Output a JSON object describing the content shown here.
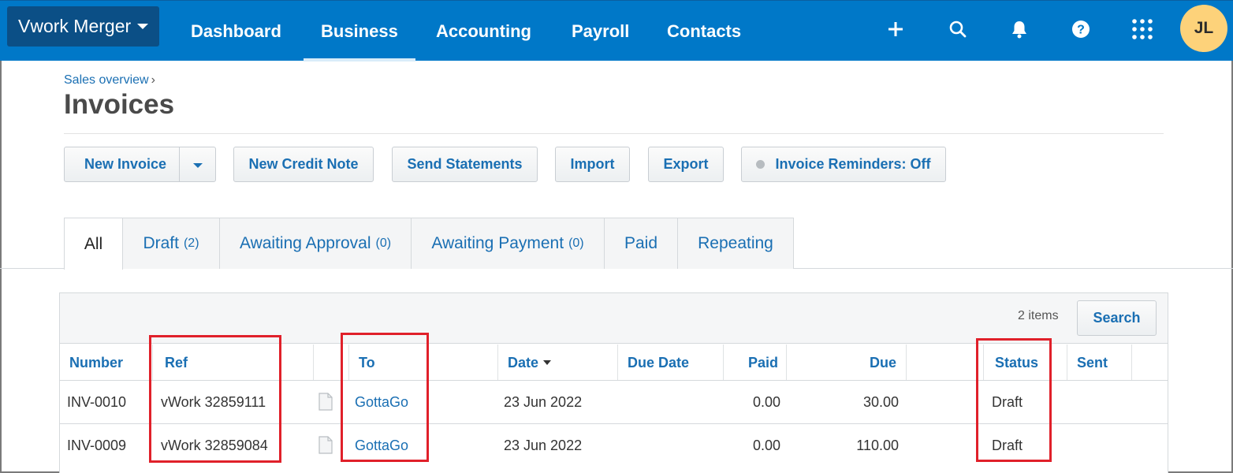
{
  "topnav": {
    "org_name": "Vwork Merger",
    "items": [
      {
        "label": "Dashboard"
      },
      {
        "label": "Business"
      },
      {
        "label": "Accounting"
      },
      {
        "label": "Payroll"
      },
      {
        "label": "Contacts"
      }
    ],
    "active": "Business",
    "icons": [
      "plus-icon",
      "search-icon",
      "bell-icon",
      "help-icon",
      "apps-grid-icon"
    ],
    "avatar_initials": "JL",
    "colors": {
      "bar": "#0078c8",
      "org_button": "#0b4f86",
      "avatar": "#fdd27a"
    }
  },
  "breadcrumb": {
    "label": "Sales overview",
    "separator": "›"
  },
  "page_title": "Invoices",
  "toolbar": {
    "new_invoice": "New Invoice",
    "new_credit_note": "New Credit Note",
    "send_statements": "Send Statements",
    "import": "Import",
    "export": "Export",
    "invoice_reminders": "Invoice Reminders: Off"
  },
  "tabs": [
    {
      "label": "All",
      "count": ""
    },
    {
      "label": "Draft",
      "count": "(2)"
    },
    {
      "label": "Awaiting Approval",
      "count": "(0)"
    },
    {
      "label": "Awaiting Payment",
      "count": "(0)"
    },
    {
      "label": "Paid",
      "count": ""
    },
    {
      "label": "Repeating",
      "count": ""
    }
  ],
  "table": {
    "items_count": "2 items",
    "search_label": "Search",
    "columns": {
      "number": "Number",
      "ref": "Ref",
      "to": "To",
      "date": "Date",
      "due_date": "Due Date",
      "paid": "Paid",
      "due": "Due",
      "status": "Status",
      "sent": "Sent"
    },
    "sort_column": "Date",
    "rows": [
      {
        "number": "INV-0010",
        "ref": "vWork 32859111",
        "to": "GottaGo",
        "date": "23 Jun 2022",
        "due_date": "",
        "paid": "0.00",
        "due": "30.00",
        "status": "Draft",
        "sent": ""
      },
      {
        "number": "INV-0009",
        "ref": "vWork 32859084",
        "to": "GottaGo",
        "date": "23 Jun 2022",
        "due_date": "",
        "paid": "0.00",
        "due": "110.00",
        "status": "Draft",
        "sent": ""
      }
    ]
  },
  "highlight_color": "#e0202a",
  "link_color": "#1a6fb3"
}
